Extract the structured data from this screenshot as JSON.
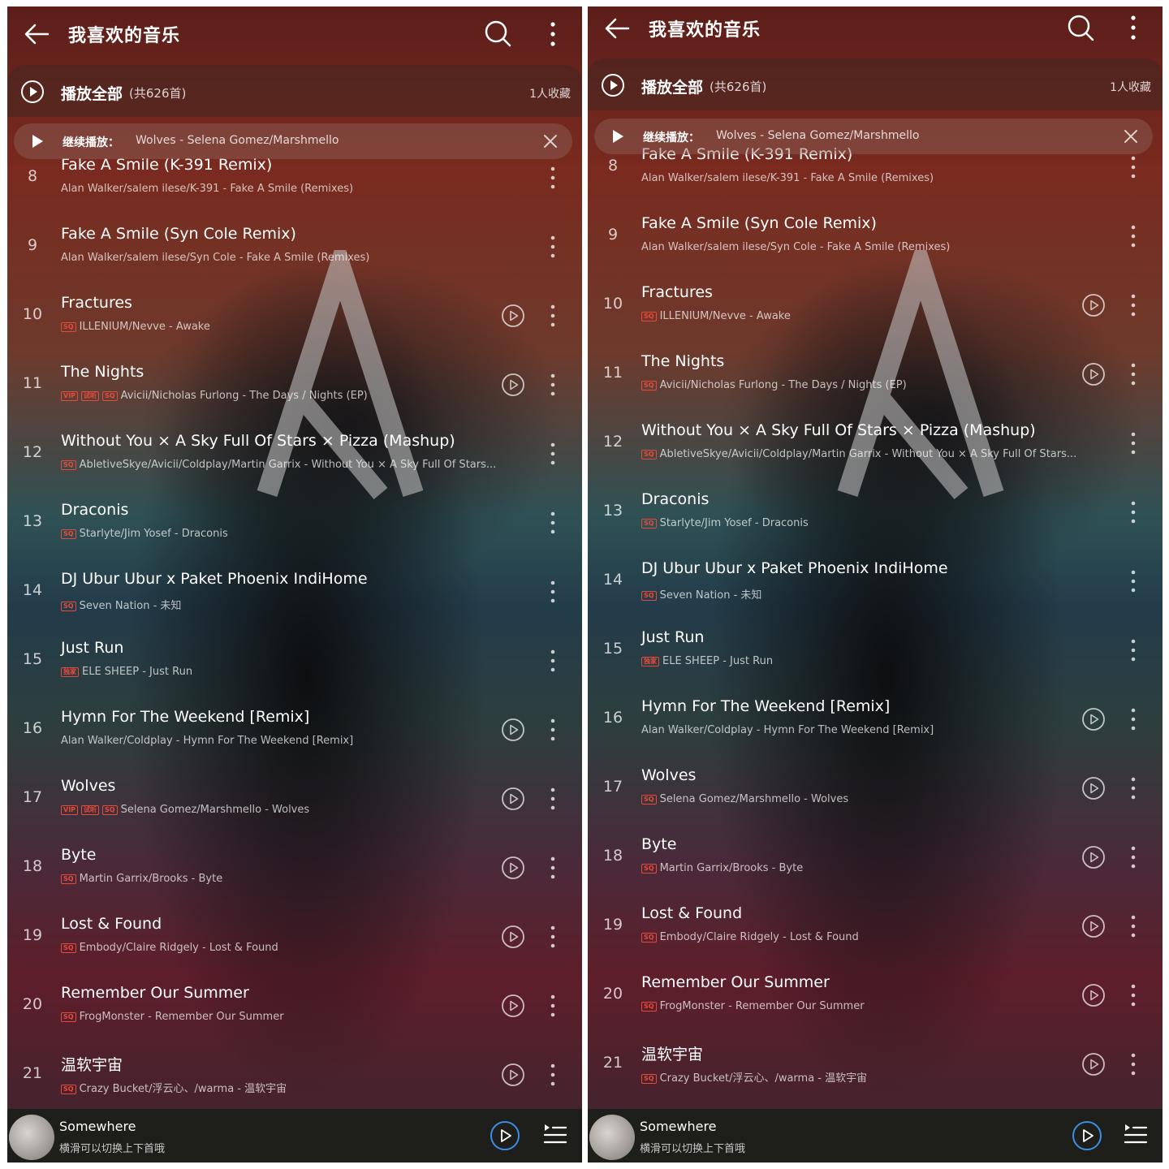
{
  "header": {
    "title": "我喜欢的音乐",
    "back_icon": "arrow-left-icon",
    "search_icon": "search-icon",
    "more_icon": "more-vertical-icon"
  },
  "play_all": {
    "label": "播放全部",
    "count": "(共626首)",
    "favorites": "1人收藏"
  },
  "resume": {
    "label": "继续播放：",
    "track": "Wolves - Selena Gomez/Marshmello"
  },
  "tracks_left": [
    {
      "num": "8",
      "title": "Fake A Smile (K-391 Remix)",
      "badges": [],
      "sub": "Alan Walker/salem ilese/K-391 - Fake A Smile (Remixes)",
      "mv": false
    },
    {
      "num": "9",
      "title": "Fake A Smile (Syn Cole Remix)",
      "badges": [],
      "sub": "Alan Walker/salem ilese/Syn Cole - Fake A Smile (Remixes)",
      "mv": false
    },
    {
      "num": "10",
      "title": "Fractures",
      "badges": [
        "SQ"
      ],
      "sub": "ILLENIUM/Nevve - Awake",
      "mv": true
    },
    {
      "num": "11",
      "title": "The Nights",
      "badges": [
        "VIP",
        "试听",
        "SQ"
      ],
      "sub": "Avicii/Nicholas Furlong - The Days / Nights (EP)",
      "mv": true
    },
    {
      "num": "12",
      "title": "Without You × A Sky Full Of Stars × Pizza (Mashup)",
      "badges": [
        "SQ"
      ],
      "sub": "AbletiveSkye/Avicii/Coldplay/Martin Garrix - Without You × A Sky Full Of Stars...",
      "mv": false
    },
    {
      "num": "13",
      "title": "Draconis",
      "badges": [
        "SQ"
      ],
      "sub": "Starlyte/Jim Yosef - Draconis",
      "mv": false
    },
    {
      "num": "14",
      "title": "DJ Ubur Ubur x Paket Phoenix IndiHome",
      "badges": [
        "SQ"
      ],
      "sub": "Seven Nation - 未知",
      "mv": false
    },
    {
      "num": "15",
      "title": "Just Run",
      "badges": [
        "独家"
      ],
      "sub": "ELE SHEEP - Just Run",
      "mv": false
    },
    {
      "num": "16",
      "title": "Hymn For The Weekend [Remix]",
      "badges": [],
      "sub": "Alan Walker/Coldplay - Hymn For The Weekend [Remix]",
      "mv": true
    },
    {
      "num": "17",
      "title": "Wolves",
      "badges": [
        "VIP",
        "试听",
        "SQ"
      ],
      "sub": "Selena Gomez/Marshmello - Wolves",
      "mv": true
    },
    {
      "num": "18",
      "title": "Byte",
      "badges": [
        "SQ"
      ],
      "sub": "Martin Garrix/Brooks - Byte",
      "mv": true
    },
    {
      "num": "19",
      "title": "Lost & Found",
      "badges": [
        "SQ"
      ],
      "sub": "Embody/Claire Ridgely - Lost & Found",
      "mv": true
    },
    {
      "num": "20",
      "title": "Remember Our Summer",
      "badges": [
        "SQ"
      ],
      "sub": "FrogMonster - Remember Our Summer",
      "mv": true
    },
    {
      "num": "21",
      "title": "温软宇宙",
      "badges": [
        "SQ"
      ],
      "sub": "Crazy Bucket/浮云心、/warma - 温软宇宙",
      "mv": true
    }
  ],
  "tracks_right": [
    {
      "num": "8",
      "title": "Fake A Smile (K-391 Remix)",
      "badges": [],
      "sub": "Alan Walker/salem ilese/K-391 - Fake A Smile (Remixes)",
      "mv": false
    },
    {
      "num": "9",
      "title": "Fake A Smile (Syn Cole Remix)",
      "badges": [],
      "sub": "Alan Walker/salem ilese/Syn Cole - Fake A Smile (Remixes)",
      "mv": false
    },
    {
      "num": "10",
      "title": "Fractures",
      "badges": [
        "SQ"
      ],
      "sub": "ILLENIUM/Nevve - Awake",
      "mv": true
    },
    {
      "num": "11",
      "title": "The Nights",
      "badges": [
        "SQ"
      ],
      "sub": "Avicii/Nicholas Furlong - The Days / Nights (EP)",
      "mv": true
    },
    {
      "num": "12",
      "title": "Without You × A Sky Full Of Stars × Pizza (Mashup)",
      "badges": [
        "SQ"
      ],
      "sub": "AbletiveSkye/Avicii/Coldplay/Martin Garrix - Without You × A Sky Full Of Stars...",
      "mv": false
    },
    {
      "num": "13",
      "title": "Draconis",
      "badges": [
        "SQ"
      ],
      "sub": "Starlyte/Jim Yosef - Draconis",
      "mv": false
    },
    {
      "num": "14",
      "title": "DJ Ubur Ubur x Paket Phoenix IndiHome",
      "badges": [
        "SQ"
      ],
      "sub": "Seven Nation - 未知",
      "mv": false
    },
    {
      "num": "15",
      "title": "Just Run",
      "badges": [
        "独家"
      ],
      "sub": "ELE SHEEP - Just Run",
      "mv": false
    },
    {
      "num": "16",
      "title": "Hymn For The Weekend [Remix]",
      "badges": [],
      "sub": "Alan Walker/Coldplay - Hymn For The Weekend [Remix]",
      "mv": true
    },
    {
      "num": "17",
      "title": "Wolves",
      "badges": [
        "SQ"
      ],
      "sub": "Selena Gomez/Marshmello - Wolves",
      "mv": true
    },
    {
      "num": "18",
      "title": "Byte",
      "badges": [
        "SQ"
      ],
      "sub": "Martin Garrix/Brooks - Byte",
      "mv": true
    },
    {
      "num": "19",
      "title": "Lost & Found",
      "badges": [
        "SQ"
      ],
      "sub": "Embody/Claire Ridgely - Lost & Found",
      "mv": true
    },
    {
      "num": "20",
      "title": "Remember Our Summer",
      "badges": [
        "SQ"
      ],
      "sub": "FrogMonster - Remember Our Summer",
      "mv": true
    },
    {
      "num": "21",
      "title": "温软宇宙",
      "badges": [
        "SQ"
      ],
      "sub": "Crazy Bucket/浮云心、/warma - 温软宇宙",
      "mv": true
    }
  ],
  "now_playing": {
    "title": "Somewhere",
    "hint": "横滑可以切换上下首哦",
    "play_icon": "play-circle-icon",
    "queue_icon": "playlist-icon"
  },
  "colors": {
    "badge": "#e84a3a",
    "accent": "#3b8fe8",
    "minibar_bg": "#1e1e1a"
  }
}
